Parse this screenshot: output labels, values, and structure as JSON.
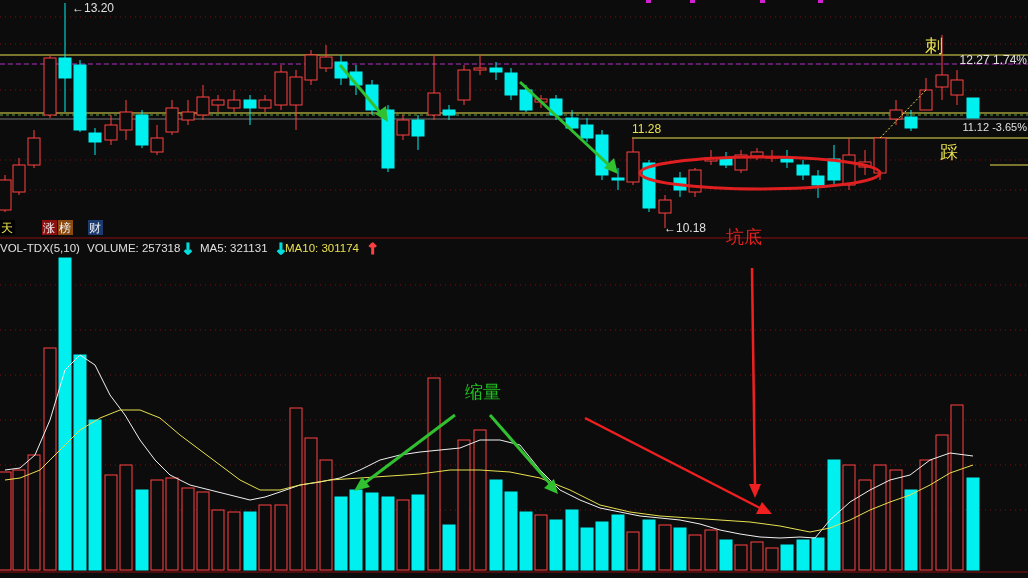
{
  "price_panel": {
    "high_label": "←13.20",
    "low_label": "←10.18",
    "level_label": "11.28",
    "upper_line_label": "12.27 1.74%",
    "lower_line_label": "11.12 -3.65%"
  },
  "annotations": [
    {
      "text": "刺",
      "color": "#e8e050"
    },
    {
      "text": "踩",
      "color": "#e8e050"
    },
    {
      "text": "坑底",
      "color": "#e02020"
    },
    {
      "text": "缩量",
      "color": "#20c020"
    }
  ],
  "badges": [
    {
      "text": "天",
      "color": "#000000"
    },
    {
      "text": "涨",
      "color": "#8c1010"
    },
    {
      "text": "榜",
      "color": "#8a4a10"
    },
    {
      "text": "财",
      "color": "#1a3a70"
    }
  ],
  "indicator": {
    "name": "VOL-TDX(5,10)",
    "items": [
      {
        "label": "VOLUME: 257318",
        "color": "#e0e0e0",
        "arrow": {
          "text": "↓",
          "color": "#00e0e0"
        }
      },
      {
        "label": "MA5: 321131",
        "color": "#e0e0e0",
        "arrow": {
          "text": "↓",
          "color": "#00e0e0"
        }
      },
      {
        "label": "MA10: 301174",
        "color": "#e8e050",
        "arrow": {
          "text": "↑",
          "color": "#ff4040"
        }
      }
    ]
  }
}
